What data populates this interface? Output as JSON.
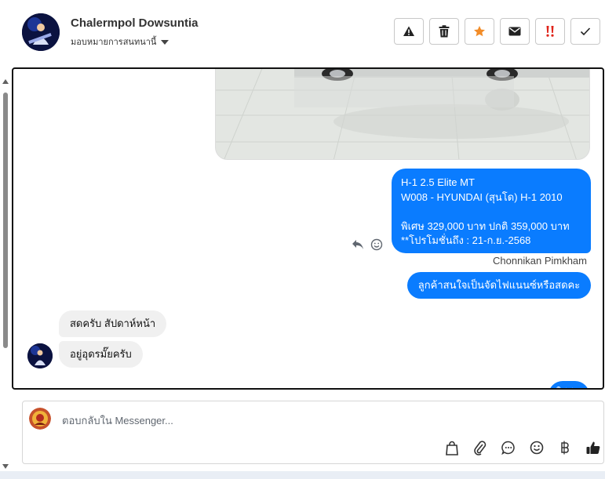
{
  "header": {
    "contact_name": "Chalermpol Dowsuntia",
    "assign_label": "มอบหมายการสนทนานี้",
    "actions": [
      {
        "icon": "warning-icon",
        "color": "#222222"
      },
      {
        "icon": "trash-icon",
        "color": "#222222"
      },
      {
        "icon": "star-icon",
        "color": "#f28c28"
      },
      {
        "icon": "envelope-icon",
        "color": "#222222"
      },
      {
        "icon": "double-exclamation-icon",
        "color": "#e0241b"
      },
      {
        "icon": "check-icon",
        "color": "#222222"
      }
    ]
  },
  "conversation": {
    "outgoing_1": "H-1 2.5 Elite MT\nW008 - HYUNDAI (สุนโด) H-1 2010\n\nพิเศษ 329,000 บาท  ปกติ 359,000 บาท\n**โปรโมชั่นถึง : 21-ก.ย.-2568",
    "sender": "Chonnikan Pimkham",
    "outgoing_2": "ลูกค้าสนใจเป็นจัดไฟแนนซ์หรือสดคะ",
    "incoming_1": "สดครับ สัปดาห์หน้า",
    "incoming_2": "อยู่อุดรมั๊ยครับ",
    "outgoing_3_partial": "ใช่ค่ะ"
  },
  "composer": {
    "placeholder": "ตอบกลับใน Messenger...",
    "tools": [
      "bag-icon",
      "paperclip-icon",
      "chat-bubble-icon",
      "emoji-icon",
      "baht-icon",
      "thumbs-up-icon"
    ]
  },
  "colors": {
    "outgoing_bubble": "#0a7cff",
    "incoming_bubble": "#f0f0f0",
    "accent_star": "#f28c28",
    "accent_alert": "#e0241b"
  }
}
